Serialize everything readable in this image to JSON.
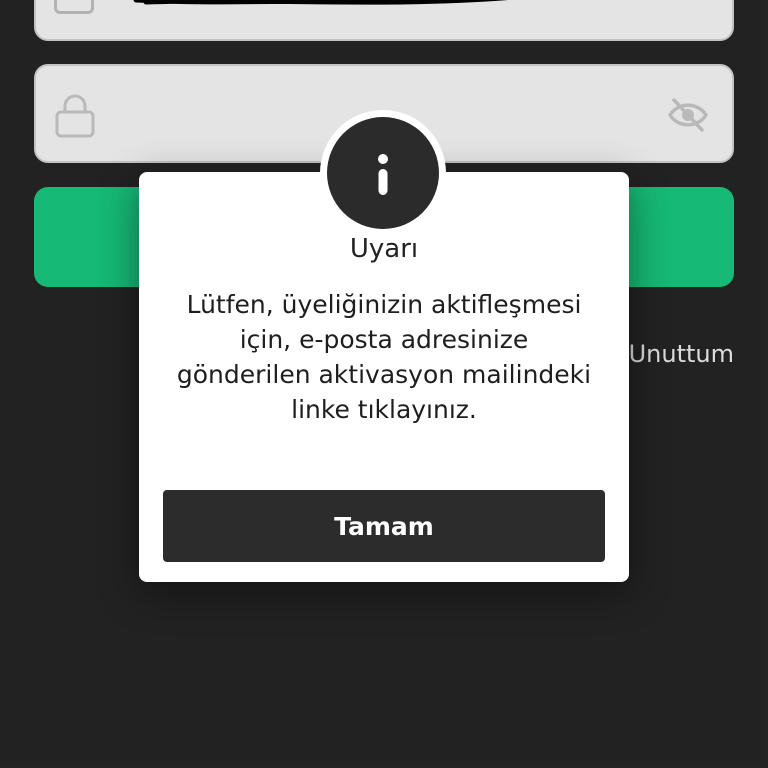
{
  "form": {
    "email_icon": "mail-icon",
    "password_icon": "lock-icon",
    "visibility_icon": "eye-slash-icon",
    "forgot_password_label": "Unuttum",
    "login_button_color": "#17c47d"
  },
  "dialog": {
    "icon": "info-icon",
    "title": "Uyarı",
    "message": "Lütfen, üyeliğinizin aktifleşmesi için, e-posta adresinize gönderilen aktivasyon mailindeki linke tıklayınız.",
    "ok_label": "Tamam"
  },
  "colors": {
    "background": "#242424",
    "accent": "#17c47d",
    "dialog_button": "#2c2c2c"
  }
}
